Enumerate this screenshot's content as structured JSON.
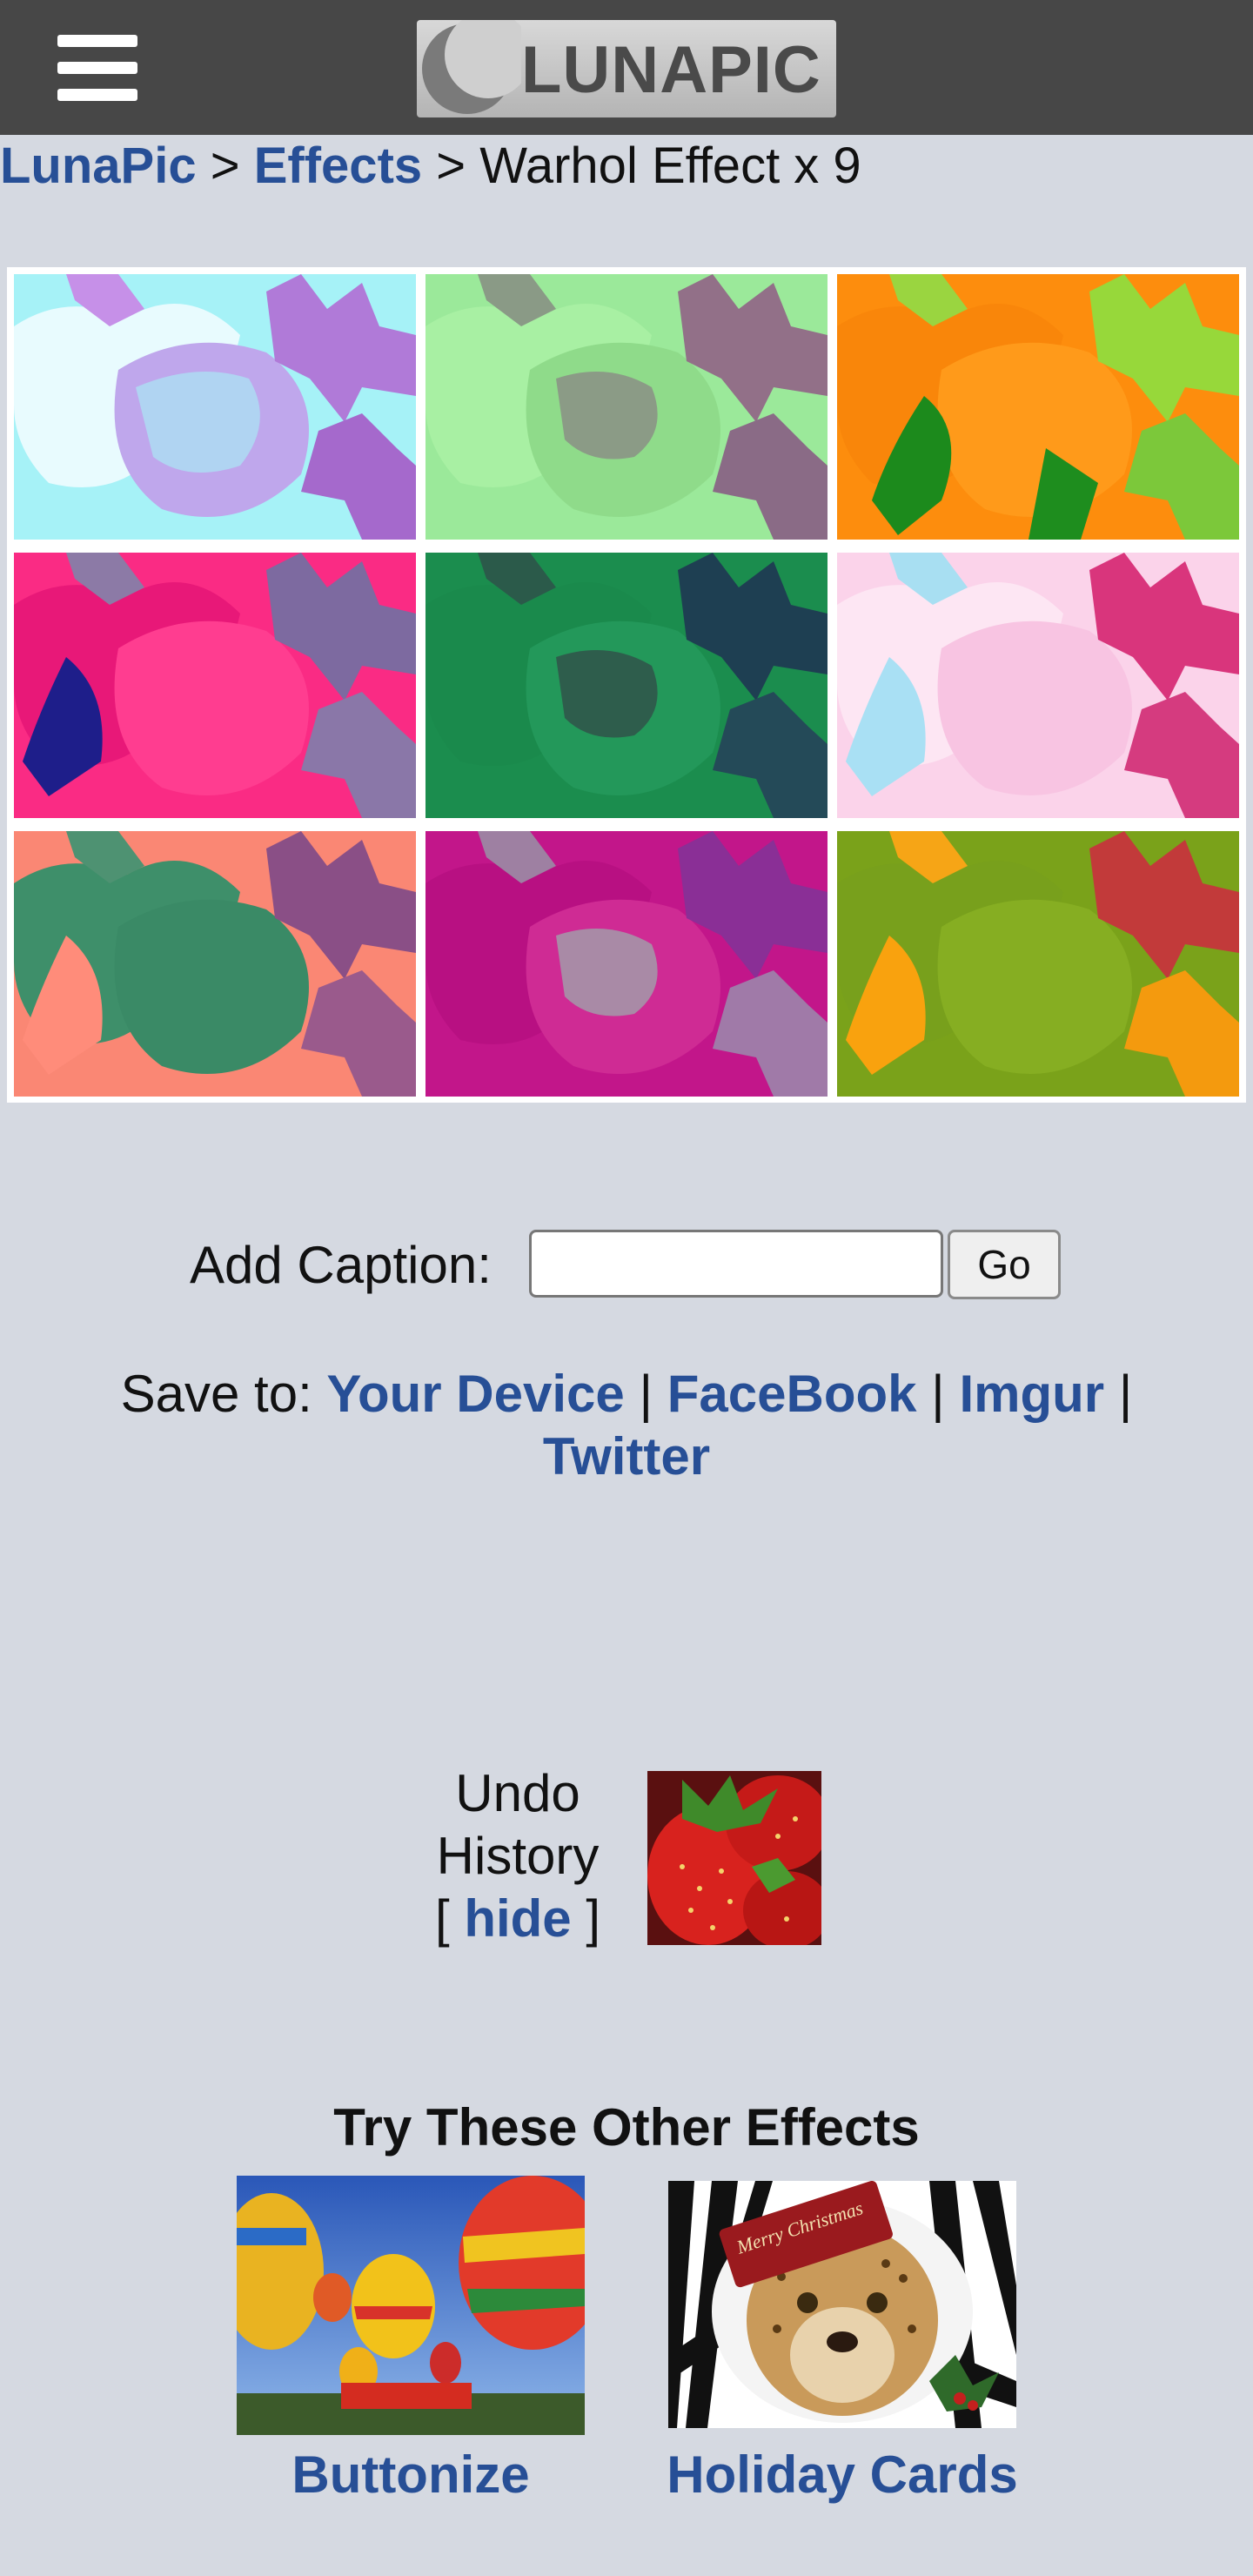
{
  "header": {
    "menu_icon": "hamburger-menu-icon",
    "logo_text": "LUNAPIC",
    "logo_icon": "crescent-moon-icon",
    "background_color": "#474747"
  },
  "breadcrumb": {
    "home": "LunaPic",
    "separator": ">",
    "section": "Effects",
    "current": "Warhol Effect x 9"
  },
  "warhol_grid": {
    "tiles": [
      {
        "name": "cyan-lavender"
      },
      {
        "name": "green-mint"
      },
      {
        "name": "orange-lime"
      },
      {
        "name": "pink-navy"
      },
      {
        "name": "dark-green"
      },
      {
        "name": "pale-pink-blue"
      },
      {
        "name": "salmon-teal"
      },
      {
        "name": "magenta-purple"
      },
      {
        "name": "olive-orange"
      }
    ]
  },
  "caption": {
    "label": "Add Caption:",
    "value": "",
    "placeholder": "",
    "go_label": "Go"
  },
  "save": {
    "label": "Save to:",
    "targets": [
      "Your Device",
      "FaceBook",
      "Imgur",
      "Twitter"
    ],
    "separator": "|"
  },
  "undo": {
    "line1": "Undo",
    "line2": "History",
    "open_bracket": "[",
    "hide_label": "hide",
    "close_bracket": "]"
  },
  "other_effects": {
    "title": "Try These Other Effects",
    "items": [
      {
        "label": "Buttonize",
        "thumb": "hot-air-balloons"
      },
      {
        "label": "Holiday Cards",
        "thumb": "cheetah-christmas-card"
      }
    ],
    "card_text": "Merry Christmas"
  },
  "colors": {
    "page_background": "#d5d9e1",
    "link": "#274f96",
    "header": "#474747"
  }
}
